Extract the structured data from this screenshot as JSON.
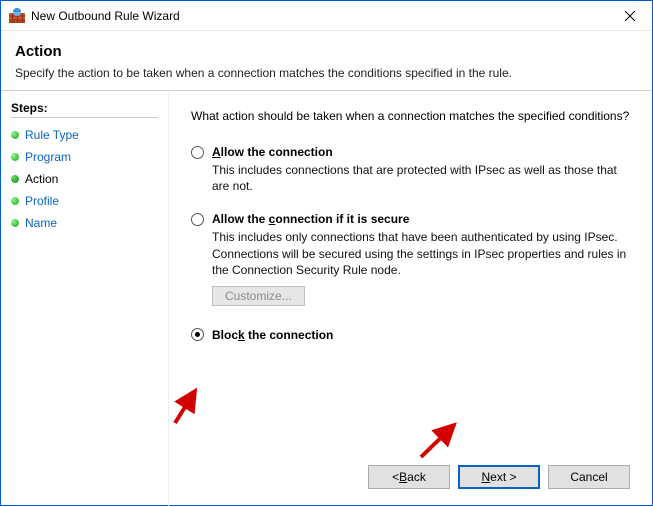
{
  "window": {
    "title": "New Outbound Rule Wizard"
  },
  "header": {
    "title": "Action",
    "description": "Specify the action to be taken when a connection matches the conditions specified in the rule."
  },
  "sidebar": {
    "label": "Steps:",
    "items": [
      {
        "label": "Rule Type",
        "active": false
      },
      {
        "label": "Program",
        "active": false
      },
      {
        "label": "Action",
        "active": true
      },
      {
        "label": "Profile",
        "active": false
      },
      {
        "label": "Name",
        "active": false
      }
    ]
  },
  "main": {
    "question": "What action should be taken when a connection matches the specified conditions?",
    "options": {
      "allow": {
        "prefix": "A",
        "rest": "llow the connection",
        "desc": "This includes connections that are protected with IPsec as well as those that are not."
      },
      "allow_secure": {
        "text": "Allow the connection if it is secure",
        "underline_index": 26,
        "desc": "This includes only connections that have been authenticated by using IPsec.  Connections will be secured using the settings in IPsec properties and rules in the Connection Security Rule node.",
        "customize_prefix": "C",
        "customize_rest": "ustomize..."
      },
      "block": {
        "text_before": "Bloc",
        "underline": "k",
        "text_after": " the connection"
      }
    }
  },
  "buttons": {
    "back_prefix": "< ",
    "back_ul": "B",
    "back_rest": "ack",
    "next_ul": "N",
    "next_rest": "ext >",
    "cancel": "Cancel"
  }
}
